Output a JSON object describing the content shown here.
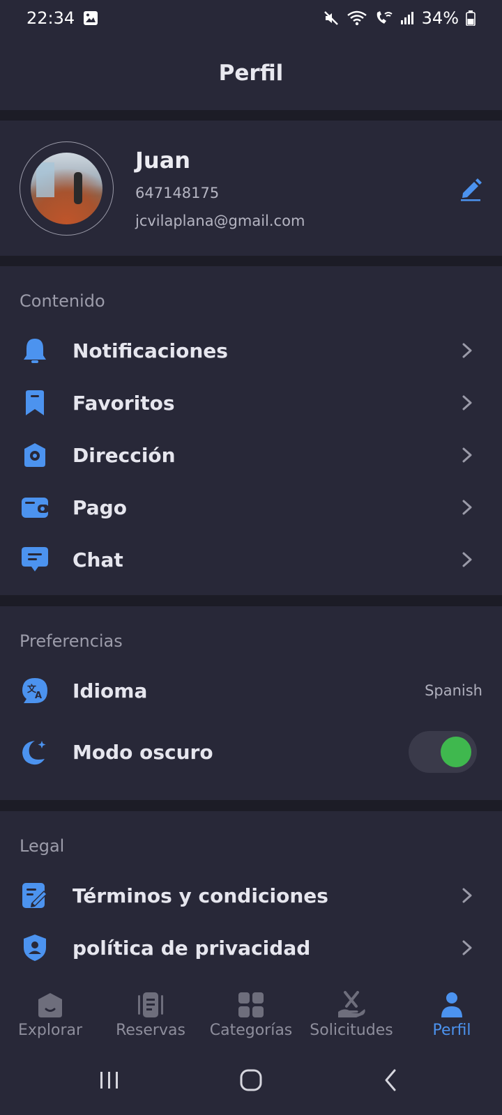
{
  "status_bar": {
    "time": "22:34",
    "battery": "34%"
  },
  "header": {
    "title": "Perfil"
  },
  "profile": {
    "name": "Juan",
    "phone": "647148175",
    "email": "jcvilaplana@gmail.com"
  },
  "contenido": {
    "title": "Contenido",
    "items": [
      {
        "label": "Notificaciones",
        "icon": "bell-icon"
      },
      {
        "label": "Favoritos",
        "icon": "bookmark-icon"
      },
      {
        "label": "Dirección",
        "icon": "location-icon"
      },
      {
        "label": "Pago",
        "icon": "wallet-icon"
      },
      {
        "label": "Chat",
        "icon": "chat-icon"
      }
    ]
  },
  "preferencias": {
    "title": "Preferencias",
    "idioma_label": "Idioma",
    "idioma_value": "Spanish",
    "dark_mode_label": "Modo oscuro",
    "dark_mode_on": true
  },
  "legal": {
    "title": "Legal",
    "items": [
      {
        "label": "Términos y condiciones",
        "icon": "terms-icon"
      },
      {
        "label": "política de privacidad",
        "icon": "shield-user-icon"
      }
    ]
  },
  "bottom_nav": {
    "items": [
      {
        "label": "Explorar",
        "active": false
      },
      {
        "label": "Reservas",
        "active": false
      },
      {
        "label": "Categorías",
        "active": false
      },
      {
        "label": "Solicitudes",
        "active": false
      },
      {
        "label": "Perfil",
        "active": true
      }
    ]
  },
  "colors": {
    "accent": "#4c93ef",
    "toggle_on": "#3fb84e",
    "surface": "#282838",
    "background": "#1c1c26"
  }
}
